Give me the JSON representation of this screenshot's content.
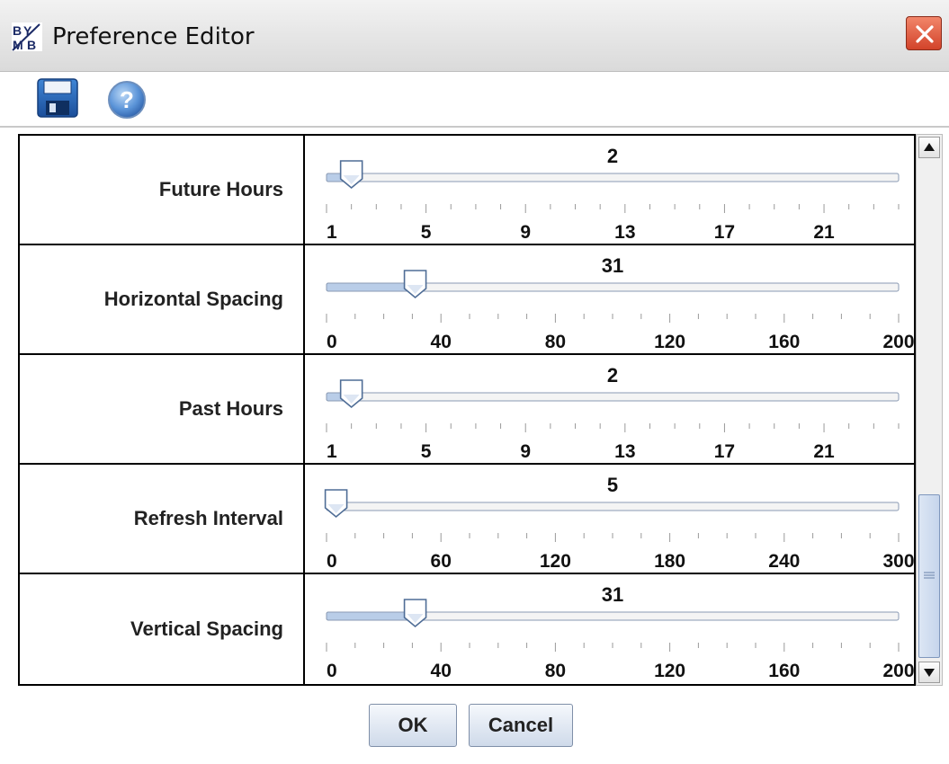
{
  "window": {
    "title": "Preference Editor",
    "app_icon": "app-logo-icon",
    "close_icon": "close-icon"
  },
  "toolbar": {
    "save_icon": "save-icon",
    "help_icon": "help-icon"
  },
  "preferences": [
    {
      "label": "Future Hours",
      "value": "2",
      "min": 1,
      "max": 24,
      "ticks": [
        "1",
        "5",
        "9",
        "13",
        "17",
        "21"
      ],
      "tick_values": [
        1,
        5,
        9,
        13,
        17,
        21
      ]
    },
    {
      "label": "Horizontal Spacing",
      "value": "31",
      "min": 0,
      "max": 200,
      "ticks": [
        "0",
        "40",
        "80",
        "120",
        "160",
        "200"
      ],
      "tick_values": [
        0,
        40,
        80,
        120,
        160,
        200
      ]
    },
    {
      "label": "Past Hours",
      "value": "2",
      "min": 1,
      "max": 24,
      "ticks": [
        "1",
        "5",
        "9",
        "13",
        "17",
        "21"
      ],
      "tick_values": [
        1,
        5,
        9,
        13,
        17,
        21
      ]
    },
    {
      "label": "Refresh Interval",
      "value": "5",
      "min": 0,
      "max": 300,
      "ticks": [
        "0",
        "60",
        "120",
        "180",
        "240",
        "300"
      ],
      "tick_values": [
        0,
        60,
        120,
        180,
        240,
        300
      ]
    },
    {
      "label": "Vertical Spacing",
      "value": "31",
      "min": 0,
      "max": 200,
      "ticks": [
        "0",
        "40",
        "80",
        "120",
        "160",
        "200"
      ],
      "tick_values": [
        0,
        40,
        80,
        120,
        160,
        200
      ]
    }
  ],
  "buttons": {
    "ok": "OK",
    "cancel": "Cancel"
  },
  "colors": {
    "close_button": "#d2432a",
    "slider_fill": "#b9cde8",
    "thumb_outline": "#4f6d96"
  }
}
